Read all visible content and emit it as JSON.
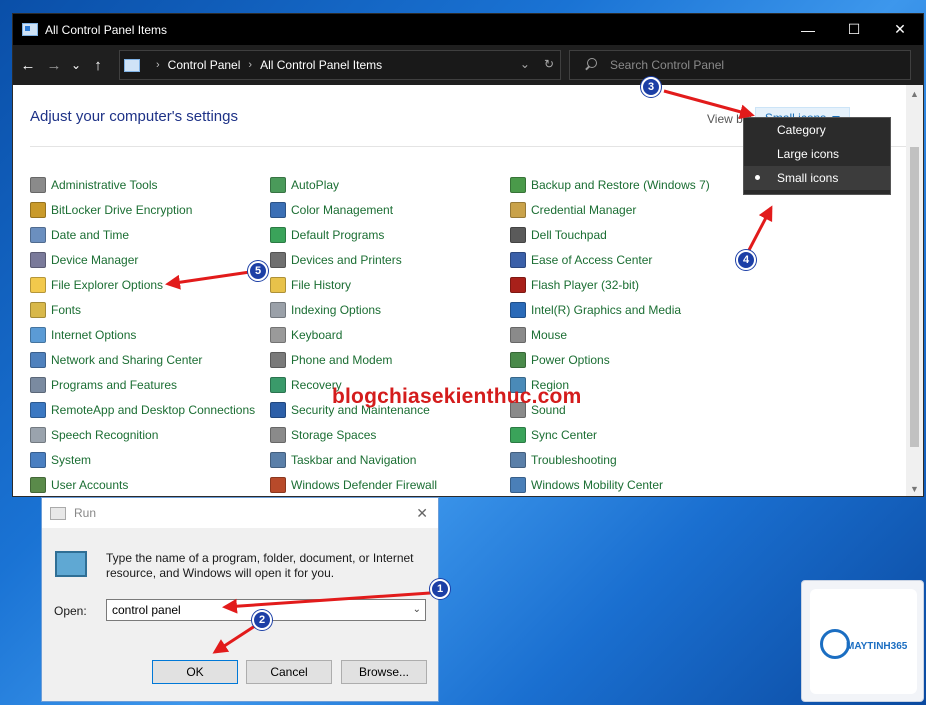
{
  "window": {
    "title": "All Control Panel Items",
    "controls": [
      "—",
      "☐",
      "✕"
    ]
  },
  "addressbar": {
    "back": "←",
    "forward": "→",
    "recent": "⌄",
    "up": "↑",
    "breadcrumb": [
      "Control Panel",
      "All Control Panel Items"
    ],
    "refresh": "↻",
    "dropdown": "⌄",
    "search_placeholder": "Search Control Panel"
  },
  "header": {
    "title": "Adjust your computer's settings",
    "view_by_label": "View by:",
    "view_by_value": "Small icons"
  },
  "view_menu": {
    "options": [
      "Category",
      "Large icons",
      "Small icons"
    ],
    "selected": "Small icons"
  },
  "items": {
    "col1": [
      {
        "label": "Administrative Tools",
        "icon": "admin-tools-icon",
        "color": "#8a8a8a"
      },
      {
        "label": "BitLocker Drive Encryption",
        "icon": "bitlocker-icon",
        "color": "#c99a2a"
      },
      {
        "label": "Date and Time",
        "icon": "clock-icon",
        "color": "#6b8fbf"
      },
      {
        "label": "Device Manager",
        "icon": "device-manager-icon",
        "color": "#7a7a9a"
      },
      {
        "label": "File Explorer Options",
        "icon": "folder-options-icon",
        "color": "#f2c94c"
      },
      {
        "label": "Fonts",
        "icon": "fonts-icon",
        "color": "#d8b84a"
      },
      {
        "label": "Internet Options",
        "icon": "internet-options-icon",
        "color": "#5b9bd5"
      },
      {
        "label": "Network and Sharing Center",
        "icon": "network-icon",
        "color": "#4f81bd"
      },
      {
        "label": "Programs and Features",
        "icon": "programs-icon",
        "color": "#7a8aa0"
      },
      {
        "label": "RemoteApp and Desktop Connections",
        "icon": "remoteapp-icon",
        "color": "#3b78c2"
      },
      {
        "label": "Speech Recognition",
        "icon": "microphone-icon",
        "color": "#9aa3ad"
      },
      {
        "label": "System",
        "icon": "system-icon",
        "color": "#4a7fc1"
      },
      {
        "label": "User Accounts",
        "icon": "user-accounts-icon",
        "color": "#5a8a4a"
      }
    ],
    "col2": [
      {
        "label": "AutoPlay",
        "icon": "autoplay-icon",
        "color": "#4a9a5a"
      },
      {
        "label": "Color Management",
        "icon": "color-management-icon",
        "color": "#3b6fb5"
      },
      {
        "label": "Default Programs",
        "icon": "default-programs-icon",
        "color": "#3aa35a"
      },
      {
        "label": "Devices and Printers",
        "icon": "printer-icon",
        "color": "#6f6f6f"
      },
      {
        "label": "File History",
        "icon": "file-history-icon",
        "color": "#e8c24a"
      },
      {
        "label": "Indexing Options",
        "icon": "indexing-icon",
        "color": "#9aa0a8"
      },
      {
        "label": "Keyboard",
        "icon": "keyboard-icon",
        "color": "#9a9a9a"
      },
      {
        "label": "Phone and Modem",
        "icon": "phone-modem-icon",
        "color": "#7a7a7a"
      },
      {
        "label": "Recovery",
        "icon": "recovery-icon",
        "color": "#3a9a6a"
      },
      {
        "label": "Security and Maintenance",
        "icon": "flag-icon",
        "color": "#2d5fa8"
      },
      {
        "label": "Storage Spaces",
        "icon": "storage-icon",
        "color": "#8a8a8a"
      },
      {
        "label": "Taskbar and Navigation",
        "icon": "taskbar-icon",
        "color": "#5a7fa8"
      },
      {
        "label": "Windows Defender Firewall",
        "icon": "firewall-icon",
        "color": "#b84a2a"
      }
    ],
    "col3": [
      {
        "label": "Backup and Restore (Windows 7)",
        "icon": "backup-icon",
        "color": "#4a9a4a"
      },
      {
        "label": "Credential Manager",
        "icon": "credential-icon",
        "color": "#c9a24a"
      },
      {
        "label": "Dell Touchpad",
        "icon": "touchpad-icon",
        "color": "#5a5a5a"
      },
      {
        "label": "Ease of Access Center",
        "icon": "ease-of-access-icon",
        "color": "#3a5fa8"
      },
      {
        "label": "Flash Player (32-bit)",
        "icon": "flash-icon",
        "color": "#a8201a"
      },
      {
        "label": "Intel(R) Graphics and Media",
        "icon": "intel-graphics-icon",
        "color": "#2a6ab8"
      },
      {
        "label": "Mouse",
        "icon": "mouse-icon",
        "color": "#8a8a8a"
      },
      {
        "label": "Power Options",
        "icon": "power-icon",
        "color": "#4a8a4a"
      },
      {
        "label": "Region",
        "icon": "region-icon",
        "color": "#4a8ab8"
      },
      {
        "label": "Sound",
        "icon": "sound-icon",
        "color": "#8a8a8a"
      },
      {
        "label": "Sync Center",
        "icon": "sync-icon",
        "color": "#3aa35a"
      },
      {
        "label": "Troubleshooting",
        "icon": "troubleshooting-icon",
        "color": "#5a7fa8"
      },
      {
        "label": "Windows Mobility Center",
        "icon": "mobility-icon",
        "color": "#4a7fb8"
      }
    ]
  },
  "watermark": "blogchiasekienthuc.com",
  "run_dialog": {
    "title": "Run",
    "close": "✕",
    "description": "Type the name of a program, folder, document, or Internet resource, and Windows will open it for you.",
    "open_label": "Open:",
    "open_value": "control panel",
    "ok_label": "OK",
    "cancel_label": "Cancel",
    "browse_label": "Browse..."
  },
  "brand": {
    "name": "MAYTINH365"
  },
  "annotations": {
    "badges": [
      "1",
      "2",
      "3",
      "4",
      "5"
    ],
    "color": "#e21b1b"
  }
}
